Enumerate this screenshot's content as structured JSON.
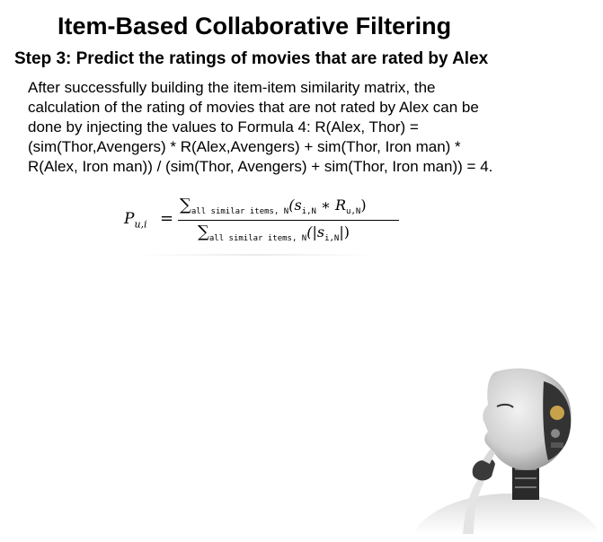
{
  "slide": {
    "title": "Item-Based Collaborative Filtering",
    "step_heading": "Step 3: Predict the ratings of movies that are rated by Alex",
    "body_lines": [
      "After successfully building the item-item similarity matrix, the",
      "calculation of the rating of movies that are not rated by Alex can be",
      "done by injecting the values to Formula 4: R(Alex, Thor) =",
      "(sim(Thor,Avengers) * R(Alex,Avengers) + sim(Thor, Iron man) *",
      "R(Alex, Iron man)) / (sim(Thor, Avengers) + sim(Thor, Iron man)) = 4."
    ]
  },
  "formula": {
    "lhs_symbol": "P",
    "lhs_subscript": "u,i",
    "equals": "=",
    "sum_symbol": "∑",
    "sum_range": "all similar items, N",
    "numerator_expr": "(s",
    "numerator_s_sub": "i,N",
    "numerator_mid": " ∗ R",
    "numerator_r_sub": "u,N",
    "numerator_close": ")",
    "denominator_expr": "(|s",
    "denominator_s_sub": "i,N",
    "denominator_close": "|)"
  },
  "illustration": {
    "name": "robot-thinking-illustration",
    "colors": {
      "skin": "#d9d9d9",
      "shadow": "#8a8a8a",
      "dark": "#222222",
      "accent": "#c8a24a"
    }
  }
}
